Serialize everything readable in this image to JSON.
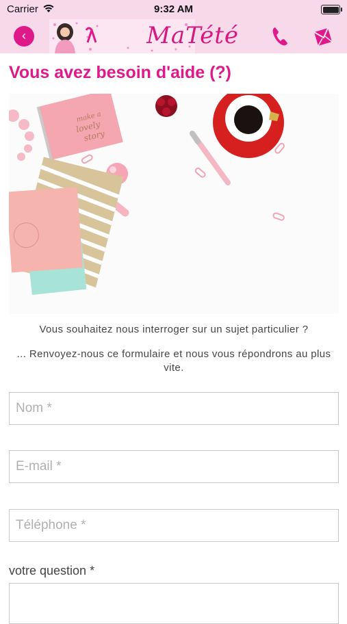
{
  "status_bar": {
    "carrier": "Carrier",
    "time": "9:32 AM"
  },
  "header": {
    "logo_text": "MaTété",
    "icons": [
      "chevron-left-icon",
      "phone-icon",
      "mail-icon"
    ],
    "accent_color": "#e0198a",
    "background_color": "#f7d9ea"
  },
  "page": {
    "title": "Vous avez besoin d'aide (?)",
    "intro_line1": "Vous souhaitez nous interroger sur un sujet particulier ?",
    "intro_line2": "... Renvoyez-nous ce formulaire et nous vous répondrons au plus vite."
  },
  "form": {
    "name_placeholder": "Nom *",
    "email_placeholder": "E-mail *",
    "phone_placeholder": "Téléphone *",
    "question_label": "votre question *"
  }
}
